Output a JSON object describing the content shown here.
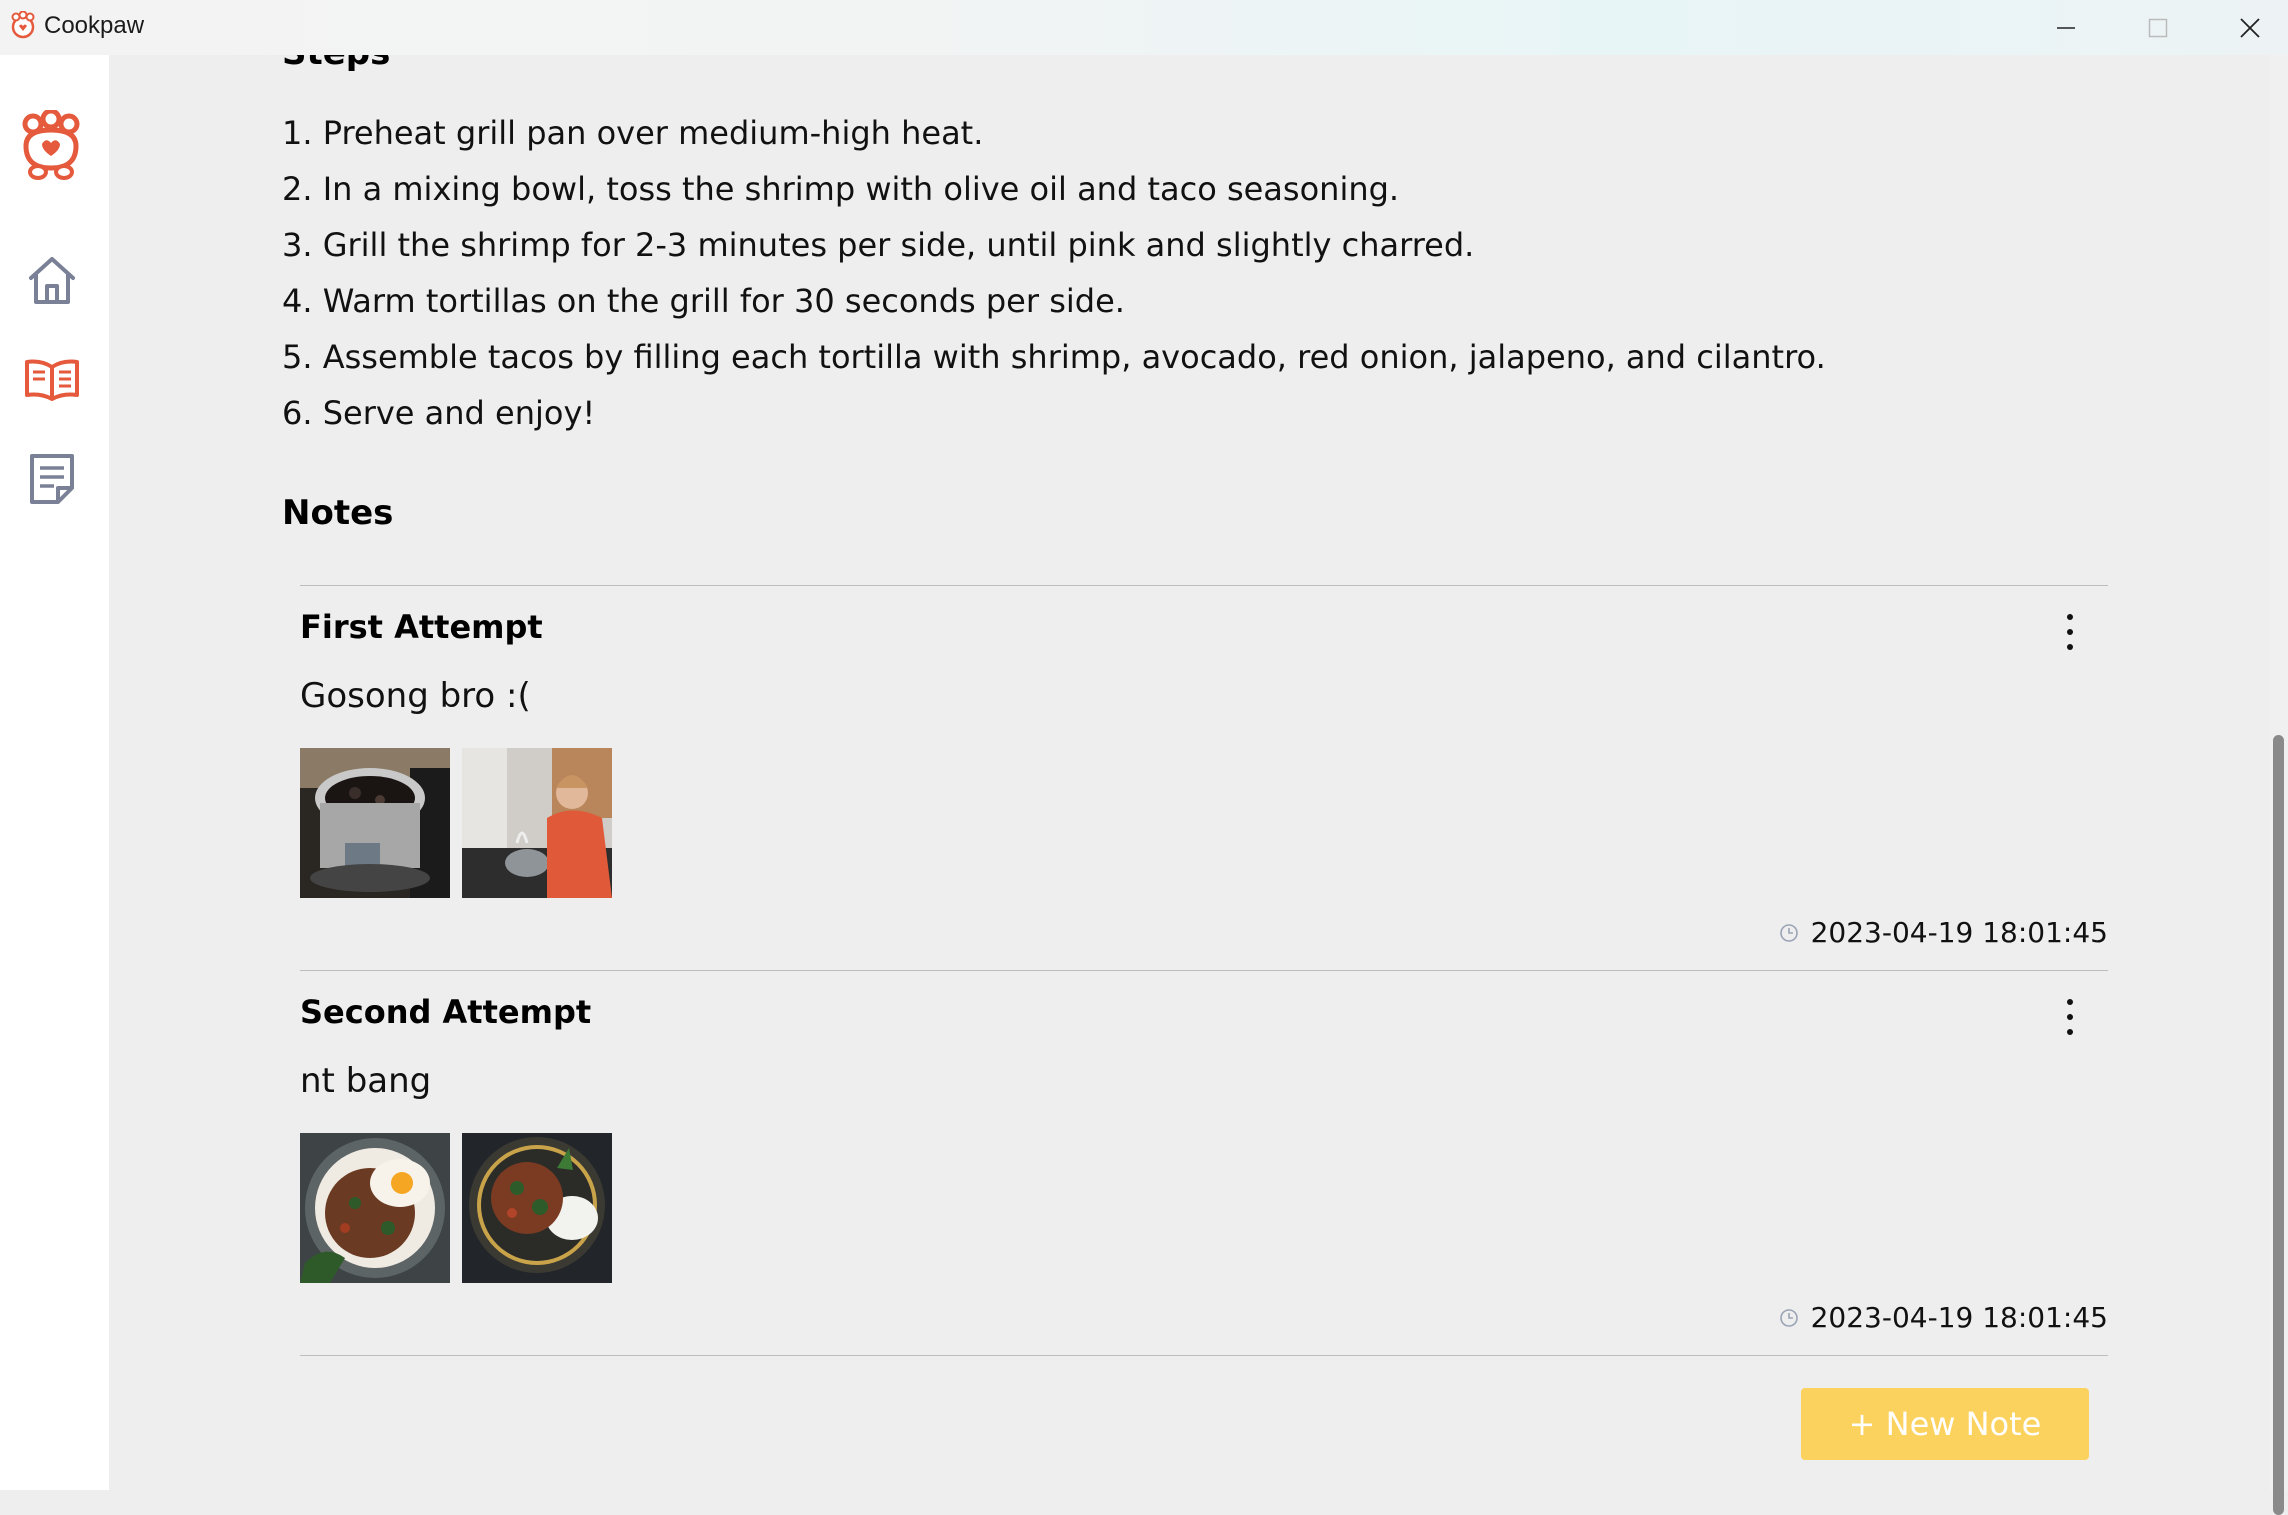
{
  "window": {
    "title": "Cookpaw",
    "controls": [
      "minimize",
      "maximize",
      "close"
    ]
  },
  "sidebar": {
    "logo_icon": "cookpaw-cat-icon",
    "items": [
      {
        "icon": "home-icon",
        "label": "Home"
      },
      {
        "icon": "book-icon",
        "label": "Recipes",
        "active": true
      },
      {
        "icon": "notes-icon",
        "label": "Notes"
      }
    ],
    "accent_color": "#e55a3c",
    "icon_color": "#7a8196"
  },
  "recipe": {
    "steps_heading": "Steps",
    "steps": [
      "1. Preheat grill pan over medium-high heat.",
      "2. In a mixing bowl, toss the shrimp with olive oil and taco seasoning.",
      "3. Grill the shrimp for 2-3 minutes per side, until pink and slightly charred.",
      "4. Warm tortillas on the grill for 30 seconds per side.",
      "5. Assemble tacos by filling each tortilla with shrimp, avocado, red onion, jalapeno, and cilantro.",
      "6. Serve and enjoy!"
    ],
    "notes_heading": "Notes",
    "notes": [
      {
        "title": "First Attempt",
        "text": "Gosong bro :(",
        "images": [
          "burnt-pot-photo",
          "stressed-cook-photo"
        ],
        "timestamp": "2023-04-19 18:01:45"
      },
      {
        "title": "Second Attempt",
        "text": "nt bang",
        "images": [
          "basil-stirfry-egg-photo",
          "basil-stirfry-bowl-photo"
        ],
        "timestamp": "2023-04-19 18:01:45"
      }
    ],
    "new_note_label": "+ New Note",
    "button_color": "#fcd25e"
  }
}
